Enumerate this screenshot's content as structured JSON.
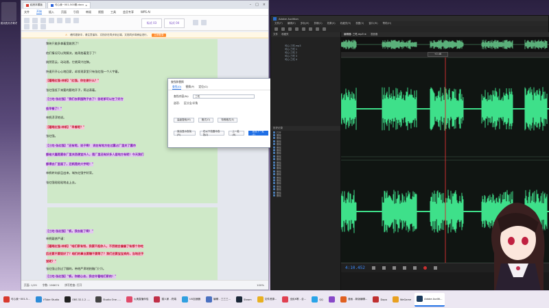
{
  "desktop": {
    "icon_label": "成功的天才奇才"
  },
  "wps": {
    "tabs": [
      {
        "label": "稻壳本模板",
        "active": false
      },
      {
        "label": "可心我~001-500期.docx",
        "active": true
      }
    ],
    "menu": [
      "文件",
      "开始",
      "插入",
      "页面",
      "引用",
      "审阅",
      "视图",
      "工具",
      "会员专享",
      "WPS AI"
    ],
    "active_menu": "开始",
    "styles": [
      "标式 03",
      "标式 04"
    ],
    "notice": {
      "text": "稿件更新中，请注意保存，文档仍在同步到云端，文档同步将稍后进行。",
      "button": "立即登录"
    },
    "lines": [
      {
        "text": "黎映只能多拿着宽姚然了!",
        "cls": ""
      },
      {
        "text": "他们情况可以到解决，她再拍着宽于了!",
        "cls": ""
      },
      {
        "text": "姚然悲云，动动眉，它就高兴红稿。",
        "cls": ""
      },
      {
        "text": "快速开开心心地回家，却发现家里只有张红强一个人宇着。",
        "cls": ""
      },
      {
        "text": "【着眼红强-林帆】\"红强，你在做什么？\"",
        "cls": "red hl-pink"
      },
      {
        "text": "张红强低下来要的额地开子，简洁表着。",
        "cls": ""
      },
      {
        "text": "【三吃-张红强】\"我们去家园院子去了！苦老爹可以在了好方",
        "cls": "purple hl-purple"
      },
      {
        "text": "些早餐了！\"",
        "cls": "purple hl-purple"
      },
      {
        "text": "林帆浮浮地说。",
        "cls": ""
      },
      {
        "text": "【着眼红强-林帆】\"早餐呢？\"",
        "cls": "red hl-pink"
      },
      {
        "text": "张红强。",
        "cls": ""
      },
      {
        "text": "【三吃-张红强】\"还有呢，说子啊！ 说在有地方在过露占厂里关了露市",
        "cls": "purple hl-purple"
      },
      {
        "text": "都给大嘉是要非厂里关西便宜外人，是厂里还有好多人居地方有呢！今天我们",
        "cls": "purple hl-purple"
      },
      {
        "text": "都得去厂里面了，还帆是的大宇呢！\"",
        "cls": "purple hl-purple"
      },
      {
        "text": "林帆转向部且出来，城东红强宇好家。",
        "cls": ""
      },
      {
        "text": "张红强哒哒哒地走上去。",
        "cls": ""
      }
    ],
    "lines2": [
      {
        "text": "【三吃-张红强】\"帆，我去能了啊！\"",
        "cls": "purple hl-purple"
      },
      {
        "text": "林帆疑惑严谨：",
        "cls": ""
      },
      {
        "text": "【着眼红强-林帆】\"咱们家有钱，我要不起你人，不然就会偏偏了有想个你吃",
        "cls": "red hl-pink"
      },
      {
        "text": "后还要不要饭好了？咱们的事业要赚不要等了？我们还要宝宝卖的，当地还手",
        "cls": "red hl-pink"
      },
      {
        "text": "觉呢？\"",
        "cls": "red hl-pink"
      },
      {
        "text": "张红强让别过了翻的，带他严肃地拍脑门(づ)。",
        "cls": ""
      },
      {
        "text": "【三吃-张红强】\"帆，你就心去，我会守着咱们家的！\"",
        "cls": "purple hl-purple"
      }
    ],
    "status": {
      "pages": "页面: 1/29",
      "words": "字数: 196674",
      "spell": "拼写检查: 打开",
      "zoom": "100%"
    }
  },
  "dialog": {
    "title": "查找和替换",
    "tabs": [
      "查找(D)",
      "替换(P)",
      "定位(G)"
    ],
    "active_tab": "查找(D)",
    "find_label": "查找内容(N):",
    "find_value": "三吃",
    "options_label": "选项:",
    "options_value": "区分全/半角",
    "btn_highlight": "突出显示查找(R)",
    "btn_format": "格式(O)",
    "btn_special": "特殊格式(E)",
    "btn_find_in": "在以下范围中查找(I)",
    "btn_prev": "上一处(B)",
    "btn_next": "查找下一处(F)",
    "btn_advanced": "高级搜索(M)"
  },
  "audition": {
    "title": "Adobe Audition",
    "menu": [
      "文件(F)",
      "编辑(E)",
      "多轨(M)",
      "剪辑(C)",
      "效果(S)",
      "收藏夹(R)",
      "视图(V)",
      "窗口(W)",
      "帮助(H)"
    ],
    "files_panel": "文件",
    "fx_panel": "收藏夹",
    "file_items": [
      "可心-三吃.mp3",
      "可心-三吃 1",
      "可心-三吃 2",
      "可心-三吃 3",
      "可心-三吃 4"
    ],
    "history_panel": "历史记录",
    "fx_items": [
      "打开",
      "删除",
      "删除",
      "删除",
      "删除",
      "删除",
      "删除",
      "删除",
      "删除",
      "删除",
      "删除",
      "删除",
      "删除",
      "删除",
      "删除",
      "删除",
      "删除",
      "删除",
      "删除",
      "删除",
      "删除",
      "删除"
    ],
    "editor_tab": "编辑器: 三吃.mp3 ≡",
    "mixer_tab": "混音器",
    "timecode": "4:10.452",
    "zoom_readout": "+0 dB",
    "colors": {
      "wave": "#3ee08a",
      "playhead": "#cc3030",
      "timecode": "#3a8cff"
    }
  },
  "taskbar": {
    "items": [
      {
        "label": "可心我~001-5...",
        "icon": "wps-icon",
        "color": "#d83a2e"
      },
      {
        "label": "VTube Studio",
        "icon": "vtube-icon",
        "color": "#2d8cd8"
      },
      {
        "label": "OBS 32.1.2 -...",
        "icon": "obs-icon",
        "color": "#222"
      },
      {
        "label": "Studio One -...",
        "icon": "studio-one-icon",
        "color": "#444"
      },
      {
        "label": "火奥直播伴侣",
        "icon": "live-icon",
        "color": "#e04a6a"
      },
      {
        "label": "猫人家 - 终端",
        "icon": "terminal-icon",
        "color": "#c03048"
      },
      {
        "label": "UU加速器",
        "icon": "uu-icon",
        "color": "#30a0e0"
      },
      {
        "label": "编辑 - 三三三...",
        "icon": "edit-icon",
        "color": "#4a70c0"
      },
      {
        "label": "Steam",
        "icon": "steam-icon",
        "color": "#1b2838"
      },
      {
        "label": "文件资源...",
        "icon": "folder-icon",
        "color": "#e8b020"
      },
      {
        "label": "全民K歌 - 合...",
        "icon": "ksong-icon",
        "color": "#e04050"
      },
      {
        "label": "QQ",
        "icon": "qq-icon",
        "color": "#2aa4e8"
      },
      {
        "label": "",
        "icon": "app-icon",
        "color": "#8848c8"
      },
      {
        "label": "漫画 - 新版编辑...",
        "icon": "comic-icon",
        "color": "#e06020"
      },
      {
        "label": "Dopo",
        "icon": "dopo-icon",
        "color": "#c03030"
      },
      {
        "label": "WeGame",
        "icon": "wegame-icon",
        "color": "#e8a020"
      },
      {
        "label": "Adobe Auditi...",
        "icon": "audition-icon",
        "color": "#1a3a5c"
      }
    ]
  }
}
